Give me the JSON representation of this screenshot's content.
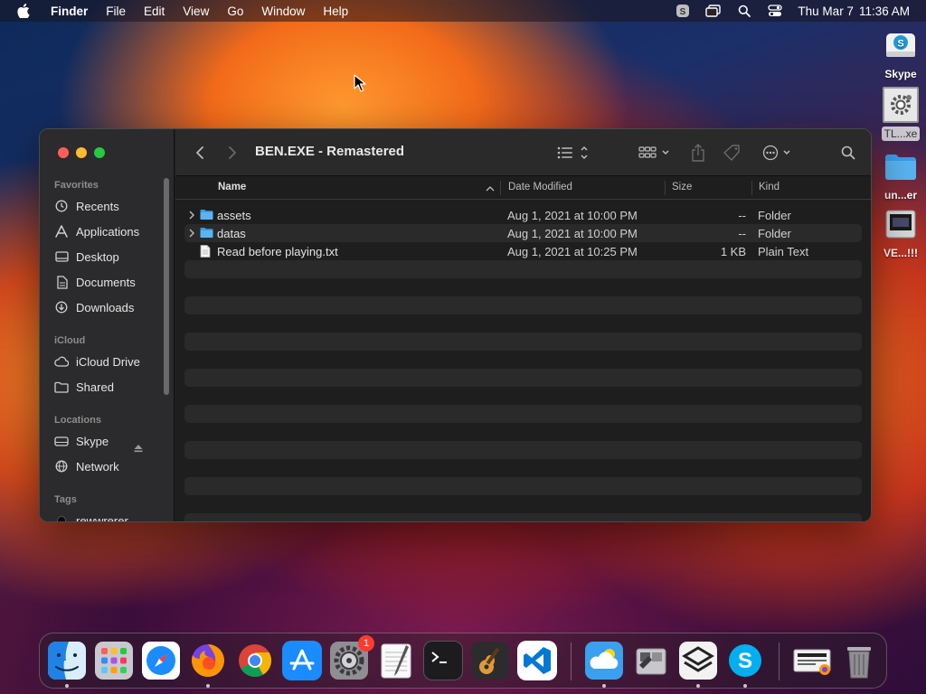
{
  "menubar": {
    "app_name": "Finder",
    "menus": [
      "File",
      "Edit",
      "View",
      "Go",
      "Window",
      "Help"
    ],
    "clock_day": "Thu Mar 7",
    "clock_time": "11:36 AM"
  },
  "desktop": {
    "icons": [
      {
        "label": "Skype",
        "icon": "skype-drive-icon"
      },
      {
        "label": "TL...xe",
        "icon": "gear-app-icon"
      },
      {
        "label": "un...er",
        "icon": "folder-icon"
      },
      {
        "label": "VE...!!!",
        "icon": "disk-image-icon"
      }
    ]
  },
  "window": {
    "title": "BEN.EXE - Remastered",
    "sidebar": {
      "favorites_label": "Favorites",
      "favorites": [
        "Recents",
        "Applications",
        "Desktop",
        "Documents",
        "Downloads"
      ],
      "icloud_label": "iCloud",
      "icloud": [
        "iCloud Drive",
        "Shared"
      ],
      "locations_label": "Locations",
      "locations": [
        "Skype",
        "Network"
      ],
      "tags_label": "Tags",
      "tags": [
        "rewwrerer"
      ]
    },
    "columns": {
      "name": "Name",
      "date": "Date Modified",
      "size": "Size",
      "kind": "Kind"
    },
    "files": [
      {
        "name": "assets",
        "date": "Aug 1, 2021 at 10:00 PM",
        "size": "--",
        "kind": "Folder",
        "type": "folder"
      },
      {
        "name": "datas",
        "date": "Aug 1, 2021 at 10:00 PM",
        "size": "--",
        "kind": "Folder",
        "type": "folder"
      },
      {
        "name": "Read before playing.txt",
        "date": "Aug 1, 2021 at 10:25 PM",
        "size": "1 KB",
        "kind": "Plain Text",
        "type": "text"
      }
    ]
  },
  "dock": {
    "apps": [
      "Finder",
      "Launchpad",
      "Safari",
      "Firefox",
      "Chrome",
      "App Store",
      "System Settings",
      "TextEdit",
      "Terminal",
      "GarageBand",
      "Visual Studio Code",
      "iCloud",
      "Boot Camp Assistant",
      "Skype Drive",
      "Skype",
      "Downloads Stack",
      "Trash"
    ],
    "settings_badge": "1"
  },
  "colors": {
    "accent": "#2f8dfb",
    "folder": "#4aa6ee",
    "close": "#ff5f57",
    "minimize": "#febc2e",
    "zoom": "#28c840"
  }
}
